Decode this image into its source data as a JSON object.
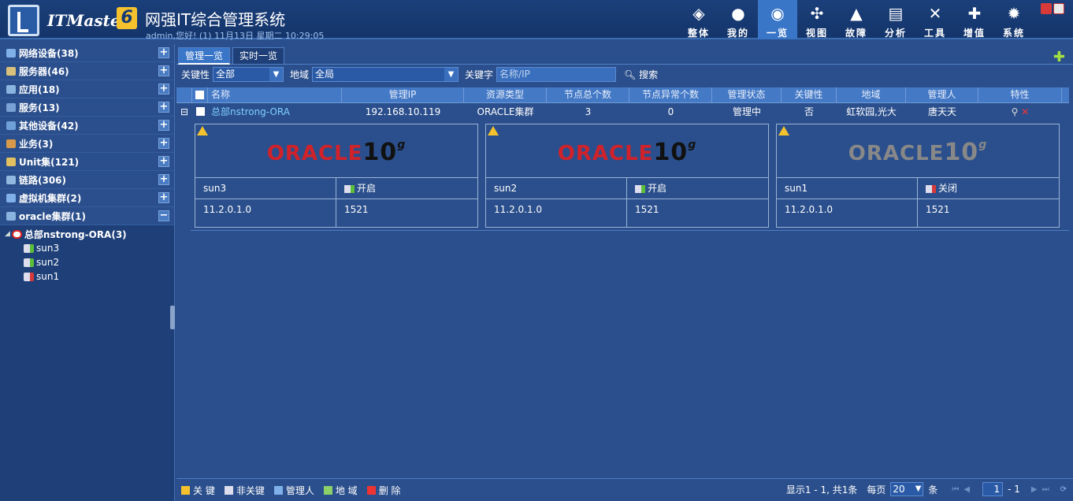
{
  "header": {
    "brand": "ITMaster",
    "brand_num": "6",
    "title": "网强IT综合管理系统",
    "subtitle": "admin,您好! (1) 11月13日 星期二 10:29:05"
  },
  "nav": [
    {
      "label": "整体",
      "icon": "layers-icon",
      "glyph": "◈"
    },
    {
      "label": "我的",
      "icon": "user-icon",
      "glyph": "●"
    },
    {
      "label": "一览",
      "icon": "overview-icon",
      "glyph": "◉"
    },
    {
      "label": "视图",
      "icon": "topology-icon",
      "glyph": "✣"
    },
    {
      "label": "故障",
      "icon": "warning-icon",
      "glyph": "▲"
    },
    {
      "label": "分析",
      "icon": "chart-icon",
      "glyph": "▤"
    },
    {
      "label": "工具",
      "icon": "tools-icon",
      "glyph": "✕"
    },
    {
      "label": "增值",
      "icon": "plus-icon",
      "glyph": "✚"
    },
    {
      "label": "系统",
      "icon": "gear-icon",
      "glyph": "✹"
    }
  ],
  "sidebar": {
    "sections": [
      {
        "label": "网络设备(38)",
        "color": "#7fb0e8"
      },
      {
        "label": "服务器(46)",
        "color": "#d8c07a"
      },
      {
        "label": "应用(18)",
        "color": "#8ab4e0"
      },
      {
        "label": "服务(13)",
        "color": "#7aa2d6"
      },
      {
        "label": "其他设备(42)",
        "color": "#6fa0d8"
      },
      {
        "label": "业务(3)",
        "color": "#d89a4a"
      },
      {
        "label": "Unit集(121)",
        "color": "#e0c060"
      },
      {
        "label": "链路(306)",
        "color": "#90b8e0"
      },
      {
        "label": "虚拟机集群(2)",
        "color": "#80b0e8"
      },
      {
        "label": "oracle集群(1)",
        "color": "#8ab4e0"
      }
    ],
    "tree": {
      "root": "总部nstrong-ORA(3)",
      "children": [
        {
          "label": "sun3",
          "state": "on"
        },
        {
          "label": "sun2",
          "state": "on"
        },
        {
          "label": "sun1",
          "state": "off"
        }
      ]
    }
  },
  "tabs": [
    "管理一览",
    "实时一览"
  ],
  "filter": {
    "crit_label": "关键性",
    "crit_value": "全部",
    "region_label": "地域",
    "region_value": "全局",
    "kw_label": "关键字",
    "kw_placeholder": "名称/IP",
    "search": "搜索"
  },
  "columns": [
    "名称",
    "管理IP",
    "资源类型",
    "节点总个数",
    "节点异常个数",
    "管理状态",
    "关键性",
    "地域",
    "管理人",
    "特性"
  ],
  "row": {
    "name": "总部nstrong-ORA",
    "ip": "192.168.10.119",
    "type": "ORACLE集群",
    "total": "3",
    "abnormal": "0",
    "state": "管理中",
    "critical": "否",
    "region": "虹软园,光大",
    "owner": "唐天天"
  },
  "nodes": [
    {
      "name": "sun3",
      "status": "开启",
      "version": "11.2.0.1.0",
      "port": "1521",
      "logo_gray": false
    },
    {
      "name": "sun2",
      "status": "开启",
      "version": "11.2.0.1.0",
      "port": "1521",
      "logo_gray": false
    },
    {
      "name": "sun1",
      "status": "关闭",
      "version": "11.2.0.1.0",
      "port": "1521",
      "logo_gray": true
    }
  ],
  "oracle_logo": {
    "word": "ORACLE",
    "num": "10",
    "sup": "g"
  },
  "footer": {
    "actions": [
      "关 键",
      "非关键",
      "管理人",
      "地 域",
      "删 除"
    ],
    "display": "显示1 - 1, 共1条",
    "per_page_label": "每页",
    "per_page": "20",
    "unit": "条",
    "page": "1",
    "page_total": "- 1"
  }
}
